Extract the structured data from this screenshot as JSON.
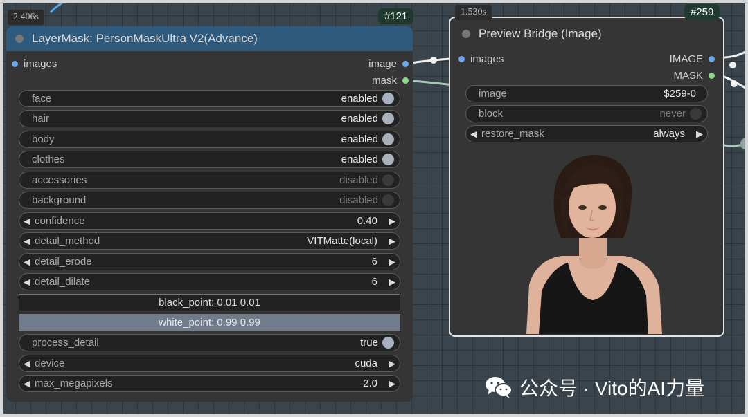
{
  "colors": {
    "canvas": "#3a444c",
    "node_body": "#353535",
    "mask_node_title": "#2e5a7e",
    "preview_node_title": "#353535",
    "badge": "#1f3a2e",
    "slot_image": "#6fa8ea",
    "slot_mask": "#8ed88e"
  },
  "mask_node": {
    "timing": "2.406s",
    "badge": "#121",
    "title": "LayerMask: PersonMaskUltra V2(Advance)",
    "input_label": "images",
    "output_image_label": "image",
    "output_mask_label": "mask",
    "toggles": [
      {
        "label": "face",
        "value": "enabled",
        "on": true
      },
      {
        "label": "hair",
        "value": "enabled",
        "on": true
      },
      {
        "label": "body",
        "value": "enabled",
        "on": true
      },
      {
        "label": "clothes",
        "value": "enabled",
        "on": true
      },
      {
        "label": "accessories",
        "value": "disabled",
        "on": false
      },
      {
        "label": "background",
        "value": "disabled",
        "on": false
      }
    ],
    "combos": [
      {
        "label": "confidence",
        "value": "0.40"
      },
      {
        "label": "detail_method",
        "value": "VITMatte(local)"
      },
      {
        "label": "detail_erode",
        "value": "6"
      },
      {
        "label": "detail_dilate",
        "value": "6"
      }
    ],
    "black_point": "black_point: 0.01  0.01",
    "white_point": "white_point: 0.99  0.99",
    "process_detail": {
      "label": "process_detail",
      "value": "true",
      "on": true
    },
    "device": {
      "label": "device",
      "value": "cuda"
    },
    "max_megapixels": {
      "label": "max_megapixels",
      "value": "2.0"
    }
  },
  "preview_node": {
    "timing": "1.530s",
    "badge": "#259",
    "title": "Preview Bridge (Image)",
    "input_label": "images",
    "output_image_label": "IMAGE",
    "output_mask_label": "MASK",
    "image_widget": {
      "label": "image",
      "value": "$259-0"
    },
    "block_widget": {
      "label": "block",
      "value": "never",
      "on": false
    },
    "restore_mask": {
      "label": "restore_mask",
      "value": "always"
    }
  },
  "watermark": {
    "icon": "wechat-icon",
    "text": "公众号 · Vito的AI力量"
  }
}
